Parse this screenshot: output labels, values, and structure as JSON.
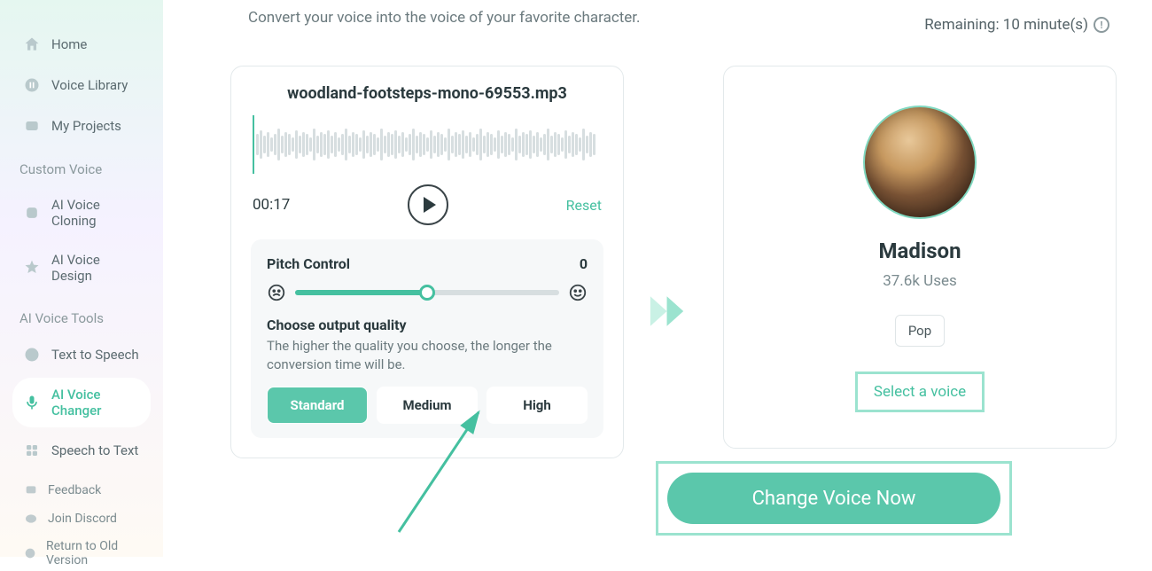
{
  "sidebar": {
    "items": [
      {
        "label": "Home"
      },
      {
        "label": "Voice Library"
      },
      {
        "label": "My Projects"
      }
    ],
    "section1": "Custom Voice",
    "custom": [
      {
        "label": "AI Voice Cloning"
      },
      {
        "label": "AI Voice Design"
      }
    ],
    "section2": "AI Voice Tools",
    "tools": [
      {
        "label": "Text to Speech"
      },
      {
        "label": "AI Voice Changer"
      },
      {
        "label": "Speech to Text"
      }
    ],
    "footer": [
      {
        "label": "Feedback"
      },
      {
        "label": "Join Discord"
      },
      {
        "label": "Return to Old Version"
      }
    ]
  },
  "header": {
    "description": "Convert your voice into the voice of your favorite character.",
    "remaining": "Remaining: 10 minute(s)"
  },
  "audio": {
    "filename": "woodland-footsteps-mono-69553.mp3",
    "time": "00:17",
    "reset": "Reset",
    "pitch_label": "Pitch Control",
    "pitch_value": "0",
    "quality_label": "Choose output quality",
    "quality_hint": "The higher the quality you choose, the longer the conversion time will be.",
    "quality_options": {
      "standard": "Standard",
      "medium": "Medium",
      "high": "High"
    }
  },
  "voice": {
    "name": "Madison",
    "uses": "37.6k Uses",
    "tag": "Pop",
    "select": "Select a voice"
  },
  "cta": "Change Voice Now"
}
